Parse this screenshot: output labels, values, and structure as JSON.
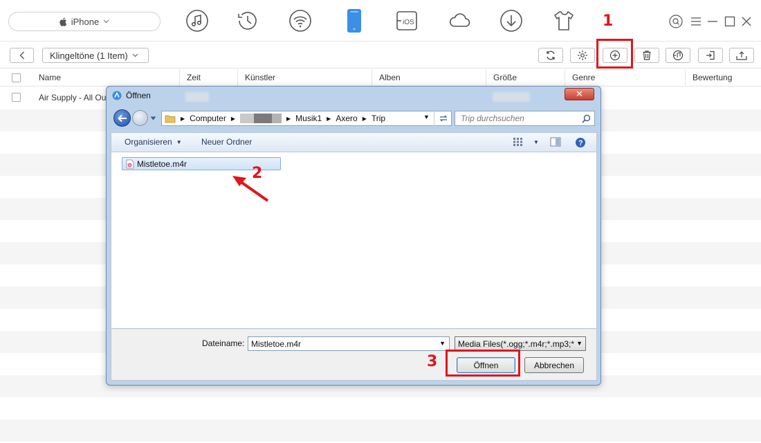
{
  "device": {
    "name": "iPhone"
  },
  "nav_icons": [
    "music-icon",
    "history-icon",
    "wifi-icon",
    "phone-icon",
    "ios-transfer-icon",
    "cloud-icon",
    "download-icon",
    "tshirt-icon"
  ],
  "window": {
    "icons": [
      "search-icon",
      "menu-icon",
      "minimize-icon",
      "maximize-icon",
      "close-icon"
    ]
  },
  "subbar": {
    "folder_label": "Klingeltöne (1 Item)",
    "tools": [
      "refresh-icon",
      "settings-icon",
      "add-icon",
      "delete-icon",
      "to-itunes-icon",
      "import-icon",
      "export-icon"
    ]
  },
  "table": {
    "columns": [
      "Name",
      "Zeit",
      "Künstler",
      "Alben",
      "Größe",
      "Genre",
      "Bewertung"
    ],
    "rows": [
      {
        "name": "Air Supply - All Ou"
      }
    ]
  },
  "annotations": {
    "one": "1",
    "two": "2",
    "three": "3"
  },
  "dialog": {
    "title": "Öffnen",
    "close": "✕",
    "path": [
      "Computer",
      "Musik1",
      "Axero",
      "Trip"
    ],
    "search_placeholder": "Trip durchsuchen",
    "organize": "Organisieren",
    "new_folder": "Neuer Ordner",
    "file": "Mistletoe.m4r",
    "filename_label": "Dateiname:",
    "filename_value": "Mistletoe.m4r",
    "filetype": "Media Files(*.ogg;*.m4r;*.mp3;*",
    "open_button": "Öffnen",
    "cancel_button": "Abbrechen"
  },
  "colors": {
    "accent": "#3a8fe6",
    "highlight": "#e3141b"
  }
}
